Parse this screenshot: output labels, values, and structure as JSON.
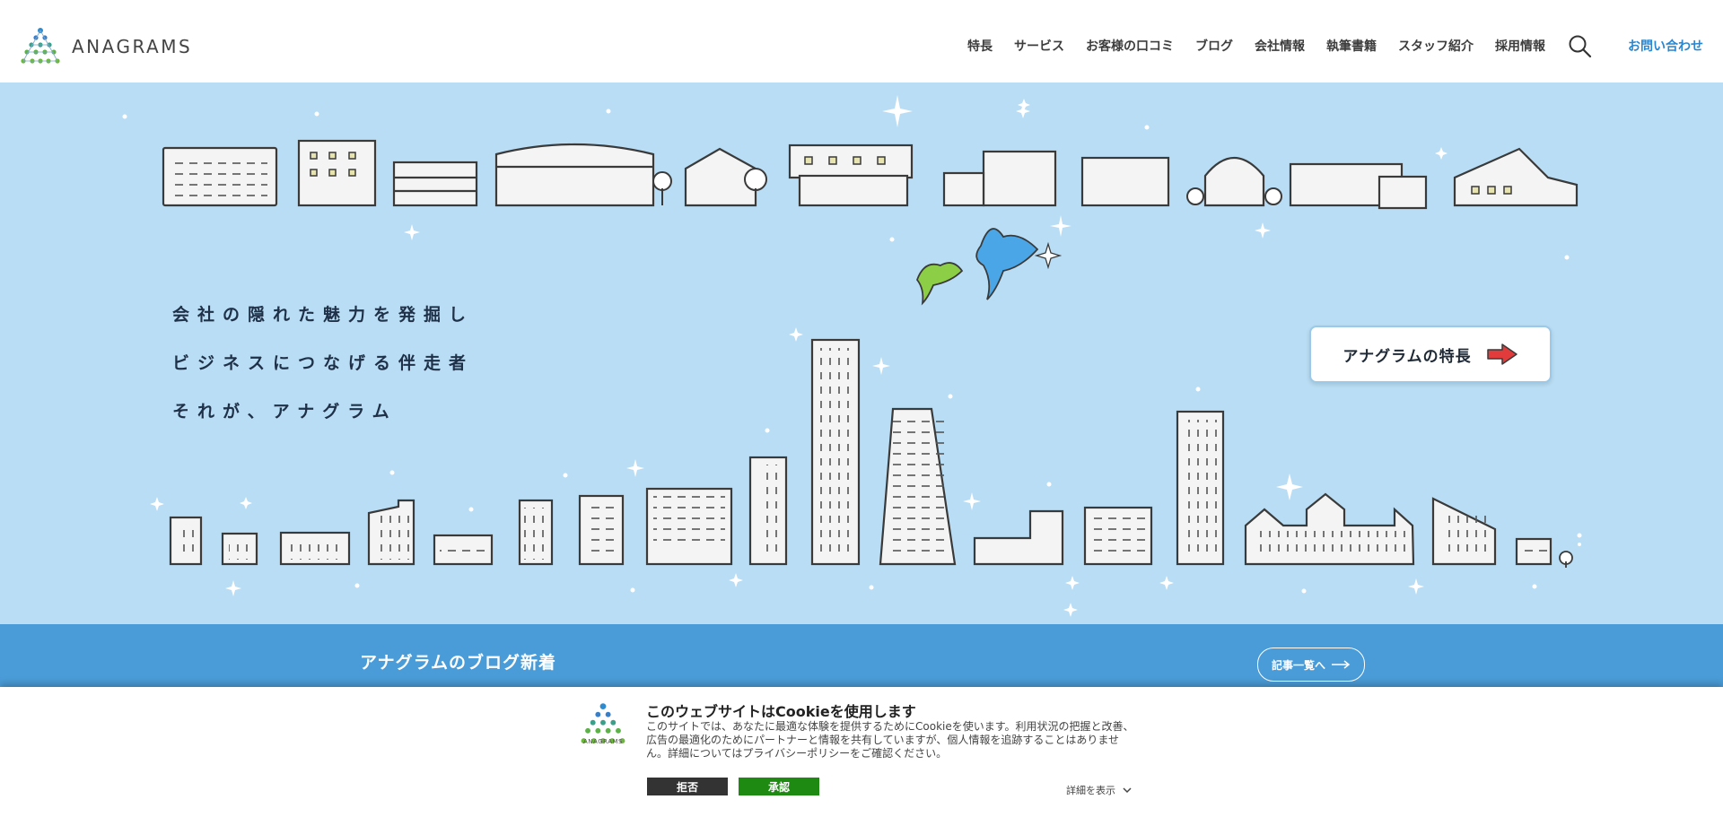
{
  "brand": {
    "logo_text": "ANAGRAMS",
    "colors": {
      "accent": "#2a86cf",
      "hero_bg": "#b9ddf4",
      "band": "#4a9cd8",
      "accept": "#1e8a12"
    }
  },
  "nav": {
    "items": [
      "特長",
      "サービス",
      "お客様の口コミ",
      "ブログ",
      "会社情報",
      "執筆書籍",
      "スタッフ紹介",
      "採用情報"
    ],
    "search_icon": "search-icon",
    "contact": "お問い合わせ"
  },
  "hero": {
    "tagline": [
      "会社の隠れた魅力を発掘し",
      "ビジネスにつなげる伴走者",
      "それが、アナグラム"
    ],
    "feature_button": "アナグラムの特長",
    "feature_arrow_icon": "red-arrow-icon"
  },
  "blog": {
    "title": "アナグラムのブログ新着",
    "more": "記事一覧へ"
  },
  "cookie": {
    "logo_text": "ANAGRAMS",
    "title": "このウェブサイトはCookieを使用します",
    "body": "このサイトでは、あなたに最適な体験を提供するためにCookieを使います。利用状況の把握と改善、広告の最適化のためにパートナーと情報を共有していますが、個人情報を追跡することはありません。詳細についてはプライバシーポリシーをご確認ください。",
    "reject": "拒否",
    "accept": "承認",
    "details": "詳細を表示"
  }
}
